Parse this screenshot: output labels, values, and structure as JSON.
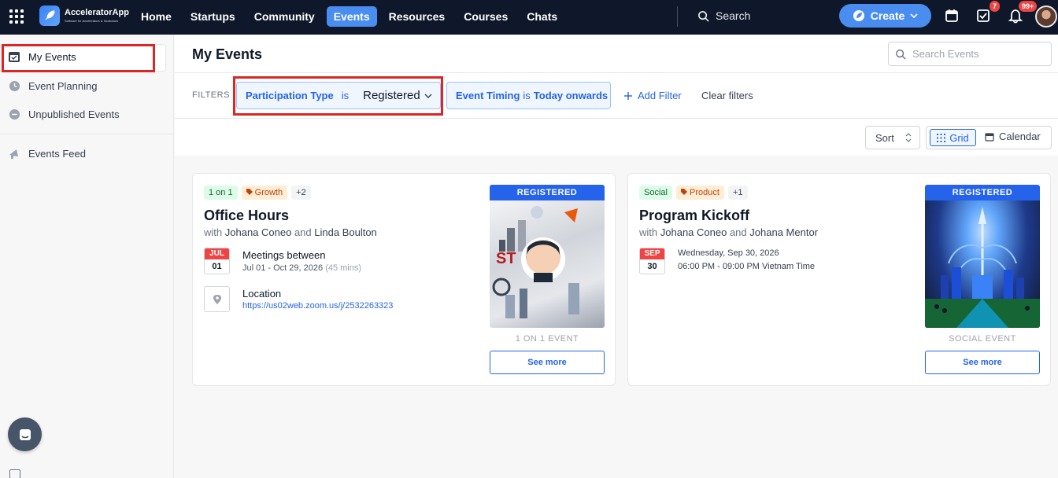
{
  "topnav": {
    "app_name": "AcceleratorApp",
    "app_tagline": "Software for Accelerators & Incubators",
    "items": [
      {
        "label": "Home"
      },
      {
        "label": "Startups"
      },
      {
        "label": "Community"
      },
      {
        "label": "Events",
        "active": true
      },
      {
        "label": "Resources"
      },
      {
        "label": "Courses"
      },
      {
        "label": "Chats"
      }
    ],
    "search_label": "Search",
    "create_label": "Create",
    "tasks_badge": "7",
    "notifications_badge": "99+"
  },
  "sidebar": {
    "items": [
      {
        "label": "My Events",
        "icon": "calendar-check-icon",
        "active": true
      },
      {
        "label": "Event Planning",
        "icon": "clock-icon"
      },
      {
        "label": "Unpublished Events",
        "icon": "minus-circle-icon"
      },
      {
        "label": "Events Feed",
        "icon": "megaphone-icon"
      }
    ]
  },
  "header": {
    "title": "My Events",
    "search_placeholder": "Search Events"
  },
  "filters": {
    "label": "FILTERS",
    "chip1": {
      "key": "Participation Type",
      "op": "is",
      "value": "Registered"
    },
    "chip2": {
      "key": "Event Timing",
      "op": "is",
      "value": "Today onwards"
    },
    "add_filter": "Add Filter",
    "clear_filters": "Clear filters"
  },
  "toolbar": {
    "sort_label": "Sort",
    "grid_label": "Grid",
    "calendar_label": "Calendar"
  },
  "events": [
    {
      "tags": [
        "1 on 1",
        "Growth",
        "+2"
      ],
      "title": "Office Hours",
      "with_prefix": "with",
      "host1": "Johana Coneo",
      "and": "and",
      "host2": "Linda Boulton",
      "month": "JUL",
      "day": "01",
      "line1": "Meetings between",
      "line2": "Jul 01 - Oct 29, 2026",
      "duration": "(45 mins)",
      "location_title": "Location",
      "location_link": "https://us02web.zoom.us/j/2532263323",
      "status": "REGISTERED",
      "type": "1 ON 1 EVENT",
      "cta": "See more"
    },
    {
      "tags": [
        "Social",
        "Product",
        "+1"
      ],
      "title": "Program Kickoff",
      "with_prefix": "with",
      "host1": "Johana Coneo",
      "and": "and",
      "host2": "Johana Mentor",
      "month": "SEP",
      "day": "30",
      "line1": "Wednesday, Sep 30, 2026",
      "line2": "06:00 PM - 09:00 PM Vietnam Time",
      "status": "REGISTERED",
      "type": "SOCIAL EVENT",
      "cta": "See more"
    }
  ],
  "colors": {
    "nav_bg": "#0f172a",
    "accent": "#4a8df0",
    "link": "#2563eb",
    "highlight": "#dc2626"
  }
}
